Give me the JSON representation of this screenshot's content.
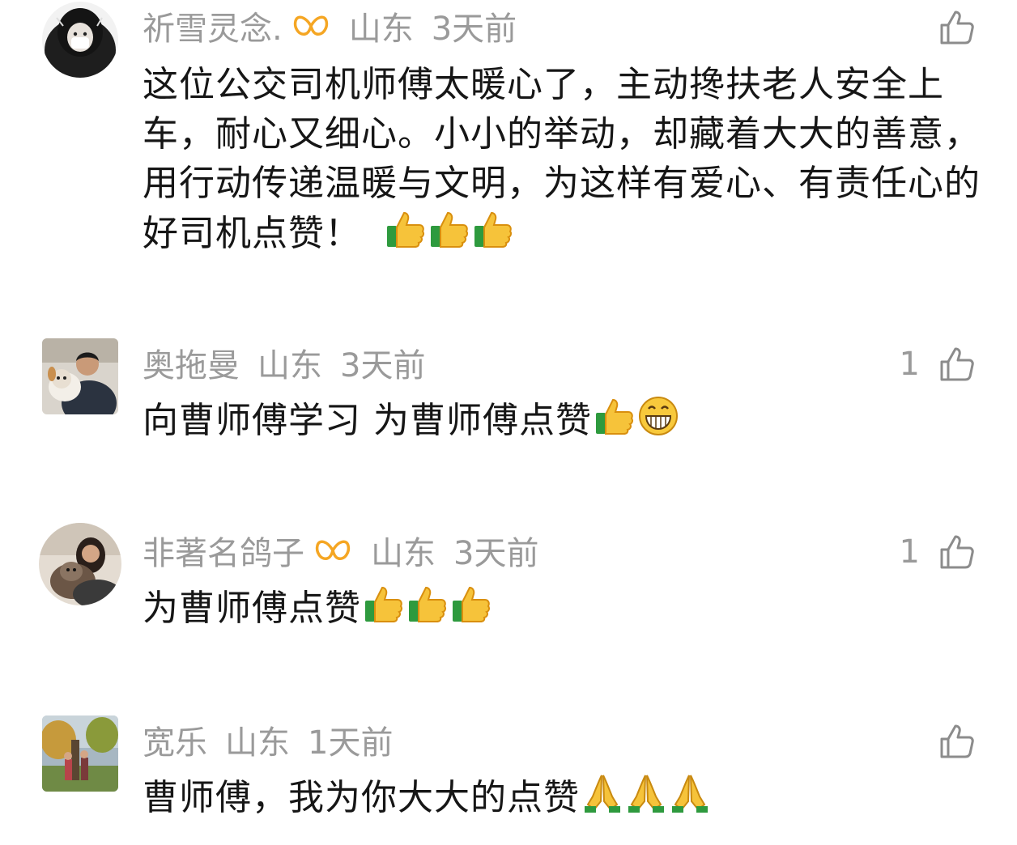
{
  "comments": [
    {
      "user": "祈雪灵念.",
      "has_badge": true,
      "location": "山东",
      "time": "3天前",
      "likes": "",
      "text": "这位公交司机师傅太暖心了，主动搀扶老人安全上车，耐心又细心。小小的举动，却藏着大大的善意，用行动传递温暖与文明，为这样有爱心、有责任心的好司机点赞！",
      "emojis": [
        "thumbs-up-icon",
        "thumbs-up-icon",
        "thumbs-up-icon"
      ]
    },
    {
      "user": "奥拖曼",
      "has_badge": false,
      "location": "山东",
      "time": "3天前",
      "likes": "1",
      "text": "向曹师傅学习 为曹师傅点赞",
      "emojis": [
        "thumbs-up-icon",
        "grinning-face-icon"
      ]
    },
    {
      "user": "非著名鸽子",
      "has_badge": true,
      "location": "山东",
      "time": "3天前",
      "likes": "1",
      "text": "为曹师傅点赞",
      "emojis": [
        "thumbs-up-icon",
        "thumbs-up-icon",
        "thumbs-up-icon"
      ]
    },
    {
      "user": "宽乐",
      "has_badge": false,
      "location": "山东",
      "time": "1天前",
      "likes": "",
      "text": "曹师傅，我为你大大的点赞",
      "emojis": [
        "pray-hands-icon",
        "pray-hands-icon",
        "pray-hands-icon"
      ]
    }
  ],
  "colors": {
    "meta_text": "#9a9a9a",
    "body_text": "#161616",
    "badge": "#f5a623"
  }
}
